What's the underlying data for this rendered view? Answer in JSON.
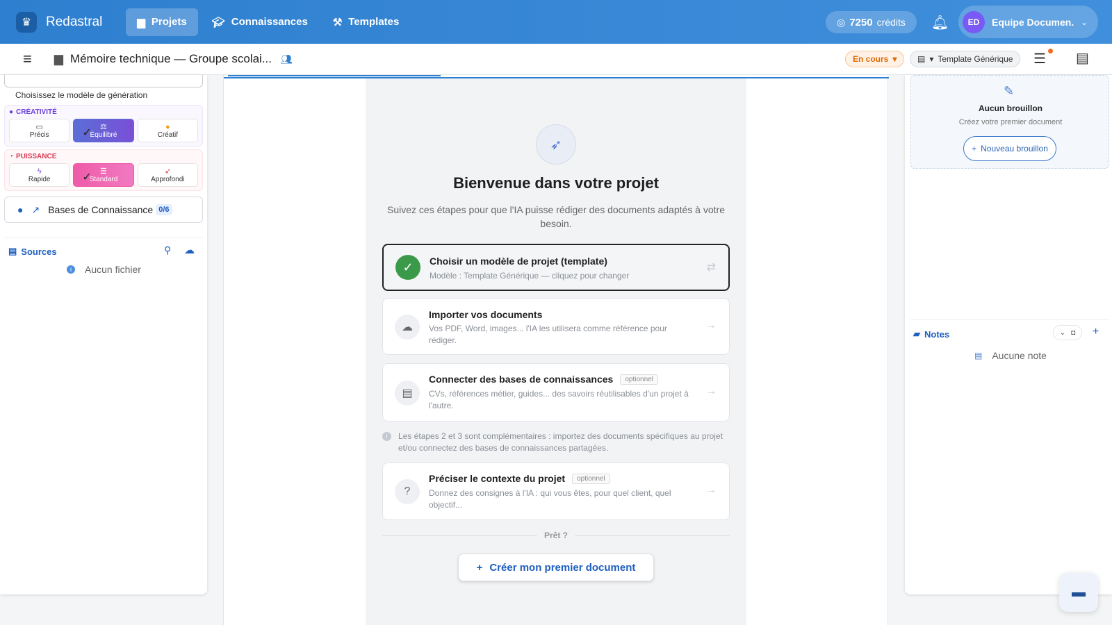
{
  "app": {
    "brand": "Redastral"
  },
  "nav": [
    {
      "label": "Projets",
      "icon": "folder-icon",
      "active": true
    },
    {
      "label": "Connaissances",
      "icon": "graduation-cap-icon",
      "active": false
    },
    {
      "label": "Templates",
      "icon": "tools-icon",
      "active": false
    }
  ],
  "header": {
    "credits_amount": "7250",
    "credits_unit": "crédits",
    "user_initials": "ED",
    "user_name": "Equipe Documen..."
  },
  "project": {
    "title": "Mémoire technique — Groupe scolai...",
    "status": "En cours",
    "template": "Template Générique"
  },
  "left_panel": {
    "gen_label": "Choisissez le modèle de génération",
    "creativity": {
      "title": "CRÉATIVITÉ",
      "options": [
        {
          "label": "Précis",
          "selected": false
        },
        {
          "label": "Équilibré",
          "selected": true
        },
        {
          "label": "Créatif",
          "selected": false
        }
      ]
    },
    "power": {
      "title": "PUISSANCE",
      "options": [
        {
          "label": "Rapide",
          "selected": false
        },
        {
          "label": "Standard",
          "selected": true
        },
        {
          "label": "Approfondi",
          "selected": false
        }
      ]
    },
    "kb": {
      "label": "Bases de Connaissance",
      "count": "0/6"
    },
    "sources": {
      "title": "Sources",
      "empty": "Aucun fichier"
    }
  },
  "main": {
    "welcome_title": "Bienvenue dans votre projet",
    "welcome_sub": "Suivez ces étapes pour que l'IA puisse rédiger des documents adaptés à votre besoin.",
    "steps": [
      {
        "title": "Choisir un modèle de projet (template)",
        "desc": "Modèle : Template Générique — cliquez pour changer",
        "done": true
      },
      {
        "title": "Importer vos documents",
        "desc": "Vos PDF, Word, images... l'IA les utilisera comme référence pour rédiger.",
        "done": false
      },
      {
        "title": "Connecter des bases de connaissances",
        "badge": "optionnel",
        "desc": "CVs, références métier, guides... des savoirs réutilisables d'un projet à l'autre.",
        "done": false
      },
      {
        "title": "Préciser le contexte du projet",
        "badge": "optionnel",
        "desc": "Donnez des consignes à l'IA : qui vous êtes, pour quel client, quel objectif...",
        "done": false
      }
    ],
    "info_note": "Les étapes 2 et 3 sont complémentaires : importez des documents spécifiques au projet et/ou connectez des bases de connaissances partagées.",
    "ready": "Prêt ?",
    "create_button": "Créer mon premier document"
  },
  "right_panel": {
    "draft_title": "Aucun brouillon",
    "draft_sub": "Créez votre premier document",
    "new_draft": "Nouveau brouillon",
    "notes_title": "Notes",
    "notes_empty": "Aucune note"
  },
  "colors": {
    "brand_blue": "#2f7fd0",
    "accent_link": "#1f5fbf",
    "success_green": "#3a9a4a",
    "status_orange": "#e06a00"
  }
}
